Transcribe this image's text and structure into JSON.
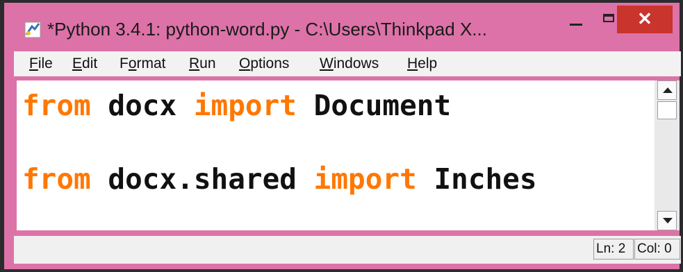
{
  "window": {
    "title": "*Python 3.4.1: python-word.py - C:\\Users\\Thinkpad X...",
    "close_glyph": "✕"
  },
  "menu": [
    {
      "label": "File",
      "underline": "F",
      "rest": "ile"
    },
    {
      "label": "Edit",
      "underline": "E",
      "rest": "dit"
    },
    {
      "label": "Format",
      "pre": "F",
      "underline": "o",
      "rest": "rmat"
    },
    {
      "label": "Run",
      "underline": "R",
      "rest": "un"
    },
    {
      "label": "Options",
      "underline": "O",
      "rest": "ptions"
    },
    {
      "label": "Windows",
      "underline": "W",
      "rest": "indows"
    },
    {
      "label": "Help",
      "underline": "H",
      "rest": "elp"
    }
  ],
  "code": {
    "line1": {
      "kw1": "from",
      "mod": " docx ",
      "kw2": "import",
      "name": " Document"
    },
    "line2": {
      "kw1": "from",
      "mod": " docx.shared ",
      "kw2": "import",
      "name": " Inches"
    }
  },
  "status": {
    "line": "Ln: 2",
    "col": "Col: 0"
  },
  "colors": {
    "frame": "#dd72a8",
    "keyword": "#ff7700",
    "close": "#c9342c"
  }
}
